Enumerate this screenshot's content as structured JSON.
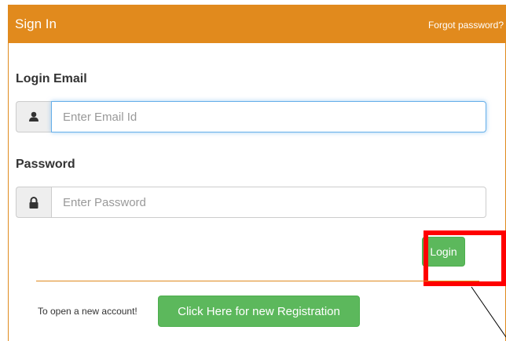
{
  "header": {
    "title": "Sign In",
    "forgot_link": "Forgot password?"
  },
  "form": {
    "email_label": "Login Email",
    "email_placeholder": "Enter Email Id",
    "password_label": "Password",
    "password_placeholder": "Enter Password",
    "login_button": "Login"
  },
  "footer": {
    "new_account_text": "To open a new account!",
    "register_button": "Click Here for new Registration"
  },
  "icons": {
    "email_addon": "user-icon",
    "password_addon": "lock-icon"
  },
  "colors": {
    "header": "#e18a1d",
    "button": "#5cb85c",
    "highlight": "#ff0000",
    "focus": "#66afe9"
  }
}
